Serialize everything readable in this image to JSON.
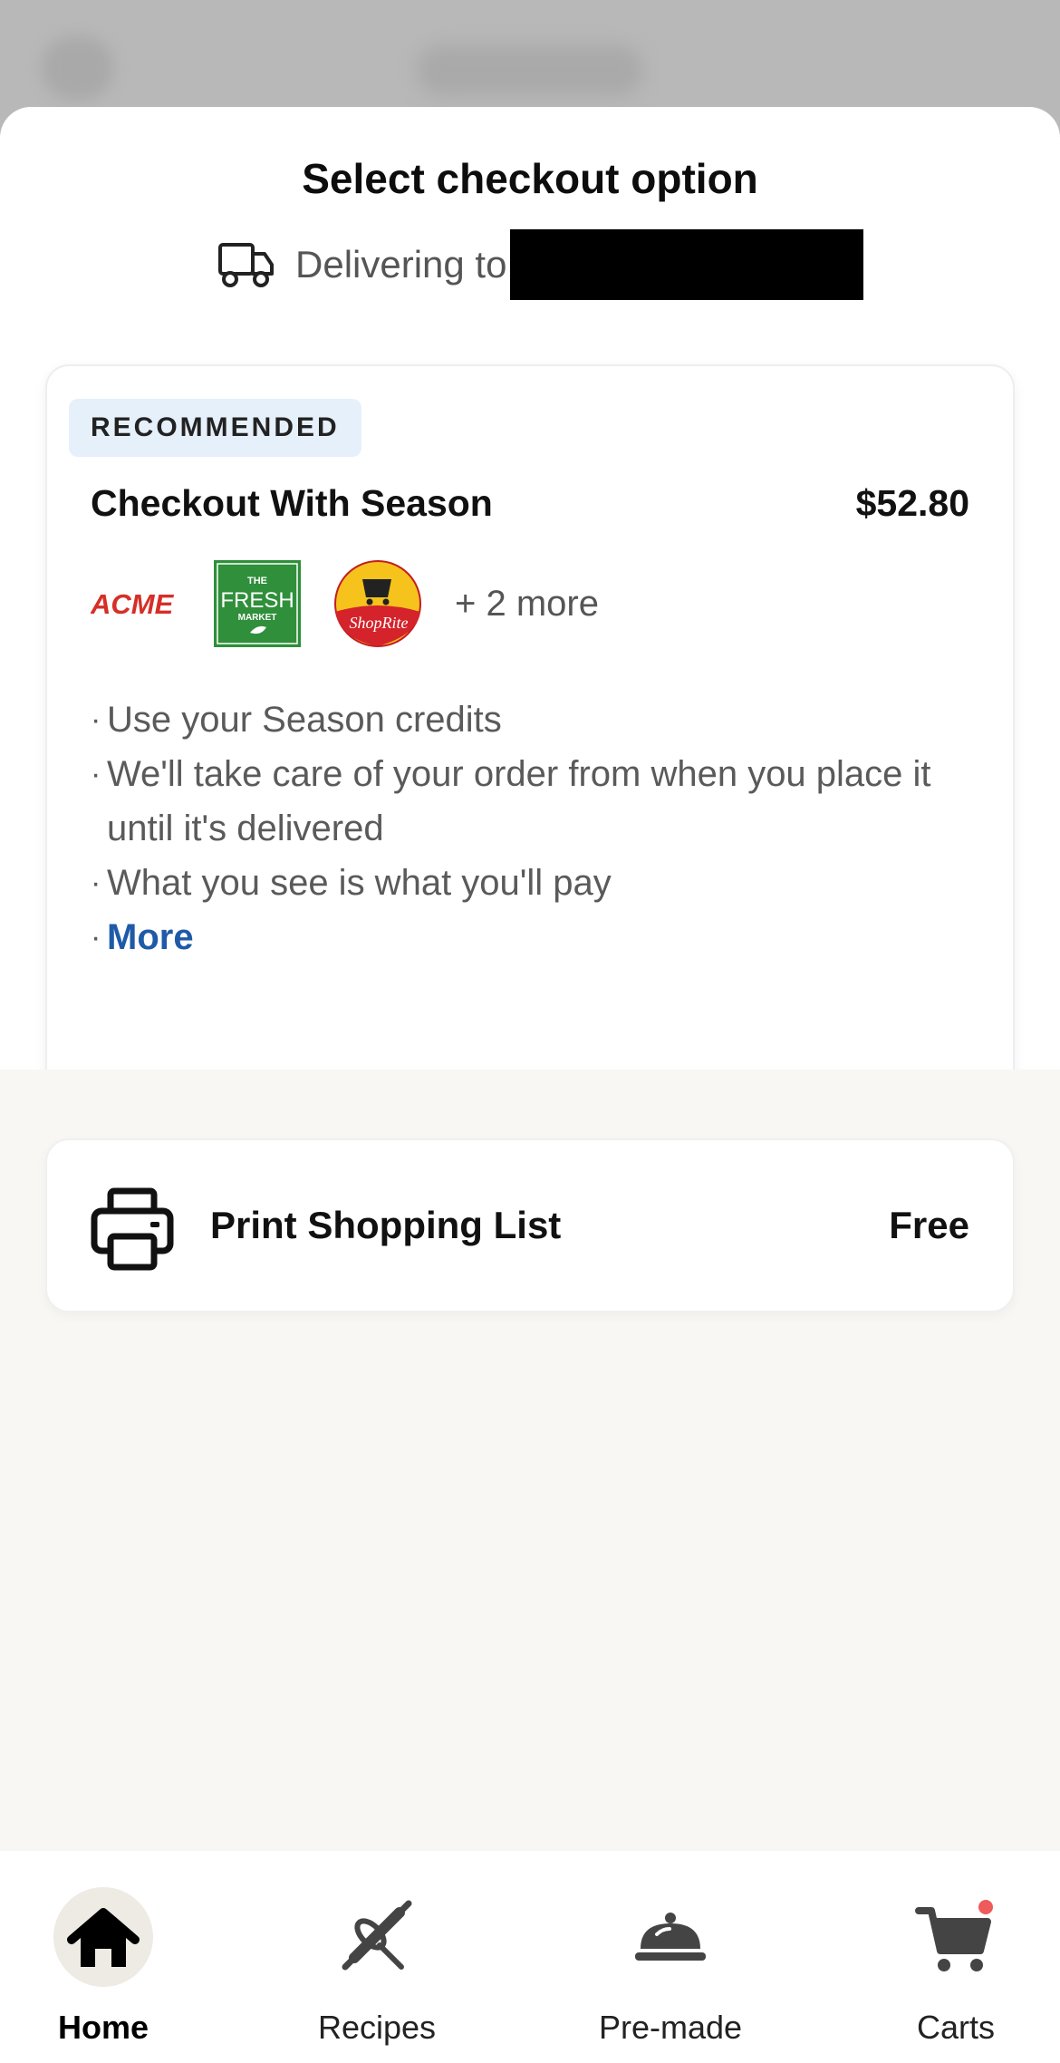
{
  "sheet": {
    "title": "Select checkout option",
    "delivering_label": "Delivering to",
    "delivering_address_redacted": true
  },
  "recommended_option": {
    "badge": "RECOMMENDED",
    "title": "Checkout With Season",
    "price": "$52.80",
    "store_logos": [
      "ACME",
      "THE FRESH MARKET",
      "ShopRite"
    ],
    "more_stores": "+ 2 more",
    "bullets": [
      "Use your Season credits",
      "We'll take care of your order from when you place it until it's delivered",
      "What you see is what you'll pay"
    ],
    "more_link": "More"
  },
  "print_option": {
    "label": "Print Shopping List",
    "price": "Free"
  },
  "tabbar": {
    "tabs": [
      {
        "label": "Home",
        "icon": "home-icon",
        "active": true
      },
      {
        "label": "Recipes",
        "icon": "rolling-pin-whisk-icon",
        "active": false
      },
      {
        "label": "Pre-made",
        "icon": "cloche-icon",
        "active": false
      },
      {
        "label": "Carts",
        "icon": "cart-icon",
        "active": false,
        "has_notification_dot": true
      }
    ]
  },
  "colors": {
    "accent_link": "#1f5aa8",
    "badge_bg": "#e6f0fb",
    "notification_dot": "#ef5a5a",
    "acme_red": "#d62f27",
    "fresh_market_green": "#2f8f3a"
  }
}
